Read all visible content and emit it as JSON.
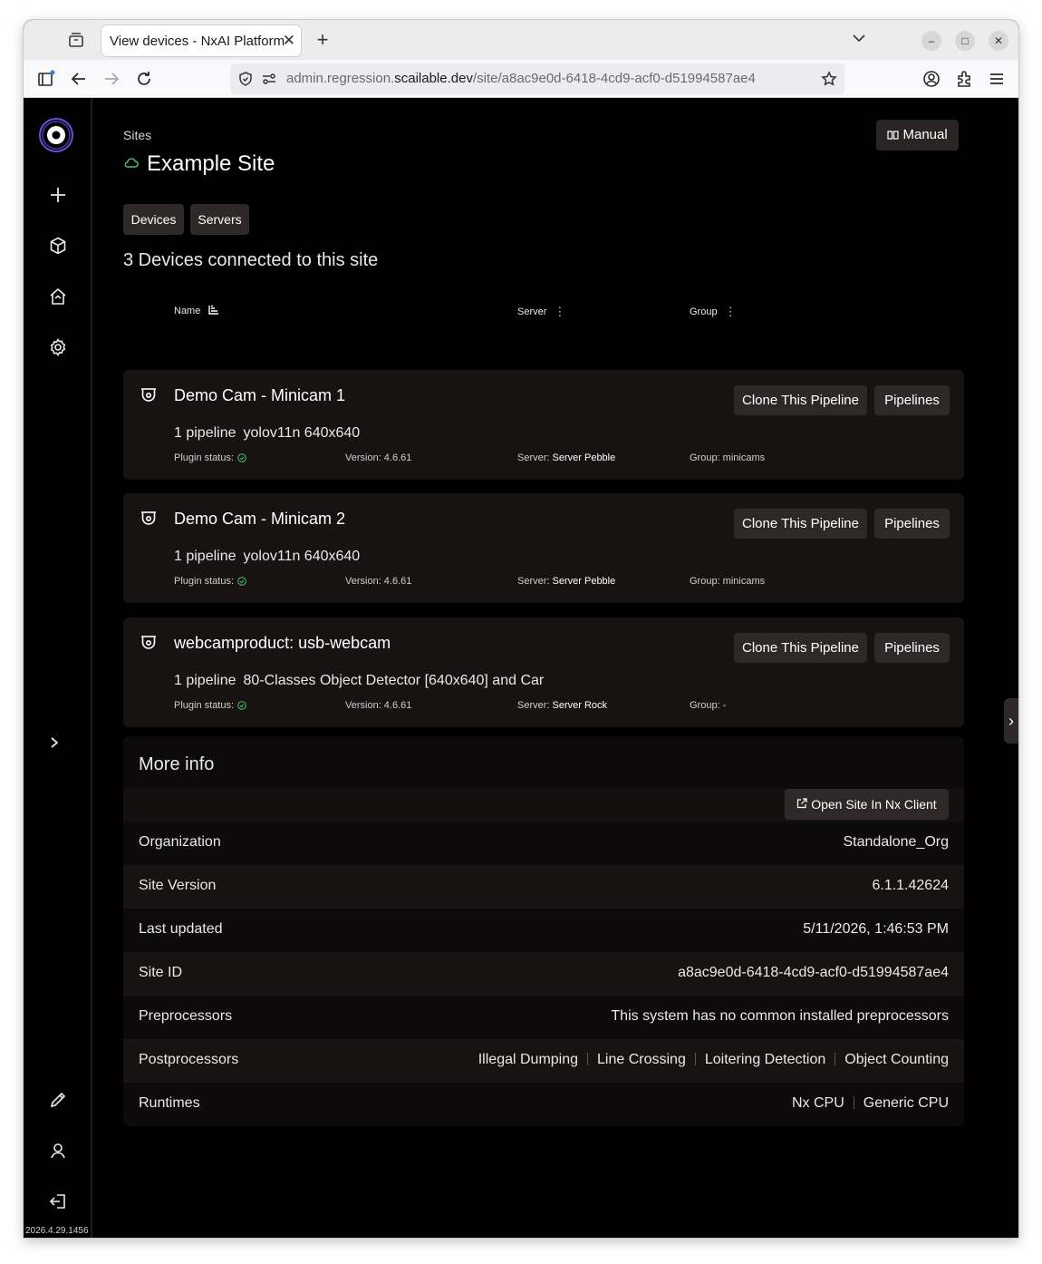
{
  "browser": {
    "tab_title": "View devices - NxAI Platform",
    "url_prefix": "admin.regression.",
    "url_domain": "scailable.dev",
    "url_path": "/site/a8ac9e0d-6418-4cd9-acf0-d51994587ae4"
  },
  "sidebar": {
    "build_version": "2026.4.29.1456",
    "icons": [
      "add-icon",
      "cube-icon",
      "home-icon",
      "settings-icon",
      "chevron-right-icon",
      "pencil-icon",
      "user-icon",
      "logout-icon"
    ]
  },
  "header": {
    "breadcrumb": "Sites",
    "title": "Example Site",
    "manual_label": "Manual",
    "tabs": [
      "Devices",
      "Servers"
    ]
  },
  "devices": {
    "count_title": "3 Devices connected to this site",
    "columns": {
      "name": "Name",
      "server": "Server",
      "group": "Group"
    },
    "items": [
      {
        "name": "Demo Cam - Minicam 1",
        "pipeline_count": "1 pipeline",
        "pipeline_model": "yolov11n 640x640",
        "plugin_status_label": "Plugin status:",
        "version": "Version: 4.6.61",
        "server_label": "Server:",
        "server": "Server Pebble",
        "group": "Group: minicams",
        "clone_label": "Clone This Pipeline",
        "pipelines_label": "Pipelines"
      },
      {
        "name": "Demo Cam - Minicam 2",
        "pipeline_count": "1 pipeline",
        "pipeline_model": "yolov11n 640x640",
        "plugin_status_label": "Plugin status:",
        "version": "Version: 4.6.61",
        "server_label": "Server:",
        "server": "Server Pebble",
        "group": "Group: minicams",
        "clone_label": "Clone This Pipeline",
        "pipelines_label": "Pipelines"
      },
      {
        "name": "webcamproduct: usb-webcam",
        "pipeline_count": "1 pipeline",
        "pipeline_model": "80-Classes Object Detector [640x640] and Car",
        "plugin_status_label": "Plugin status:",
        "version": "Version: 4.6.61",
        "server_label": "Server:",
        "server": "Server Rock",
        "group": "Group: -",
        "clone_label": "Clone This Pipeline",
        "pipelines_label": "Pipelines"
      }
    ]
  },
  "more_info": {
    "title": "More info",
    "open_client_label": "Open Site In Nx Client",
    "rows": {
      "organization": {
        "key": "Organization",
        "value": "Standalone_Org"
      },
      "site_version": {
        "key": "Site Version",
        "value": "6.1.1.42624"
      },
      "last_updated": {
        "key": "Last updated",
        "value": "5/11/2026, 1:46:53 PM"
      },
      "site_id": {
        "key": "Site ID",
        "value": "a8ac9e0d-6418-4cd9-acf0-d51994587ae4"
      },
      "preprocessors": {
        "key": "Preprocessors",
        "value": "This system has no common installed preprocessors"
      },
      "postprocessors": {
        "key": "Postprocessors",
        "values": [
          "Illegal Dumping",
          "Line Crossing",
          "Loitering Detection",
          "Object Counting"
        ]
      },
      "runtimes": {
        "key": "Runtimes",
        "values": [
          "Nx CPU",
          "Generic CPU"
        ]
      }
    }
  },
  "colors": {
    "status_ok": "#4ec26a",
    "button_bg": "#2e2828",
    "card_bg": "#171313",
    "accent_logo": "#6a4fd6"
  }
}
